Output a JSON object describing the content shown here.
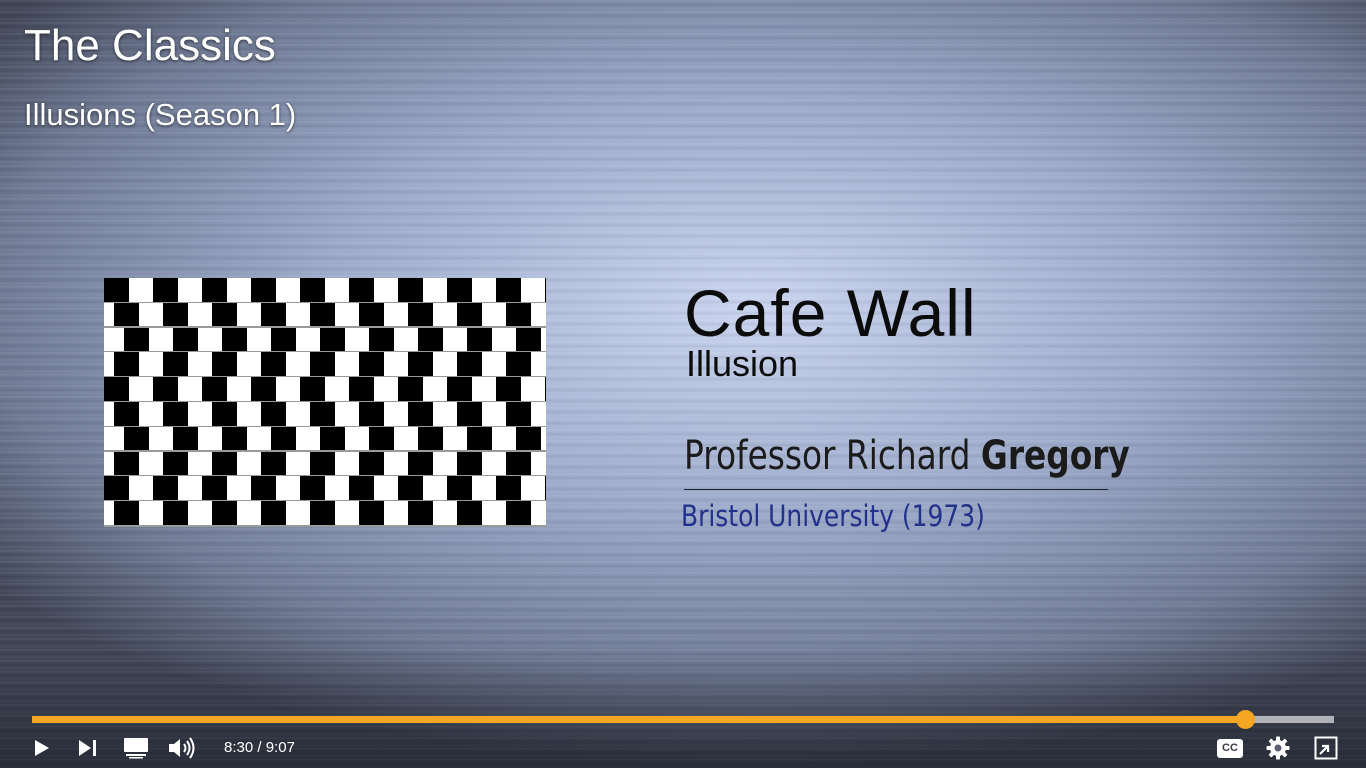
{
  "video": {
    "title": "The Classics",
    "subtitle": "Illusions (Season 1)"
  },
  "slide": {
    "heading": "Cafe Wall",
    "subheading": "Illusion",
    "presenter_prefix": "Professor Richard",
    "presenter_surname": "Gregory",
    "institution": "Bristol University (1973)"
  },
  "controls": {
    "current_time": "8:30",
    "separator": "/",
    "duration": "9:07",
    "progress_fraction": 0.932,
    "accent_color": "#f5a623",
    "icons": [
      "play-icon",
      "skip-next-icon",
      "miniplayer-icon",
      "volume-icon",
      "closed-captions-icon",
      "settings-gear-icon",
      "exit-fullscreen-icon"
    ],
    "cc_label": "CC"
  }
}
